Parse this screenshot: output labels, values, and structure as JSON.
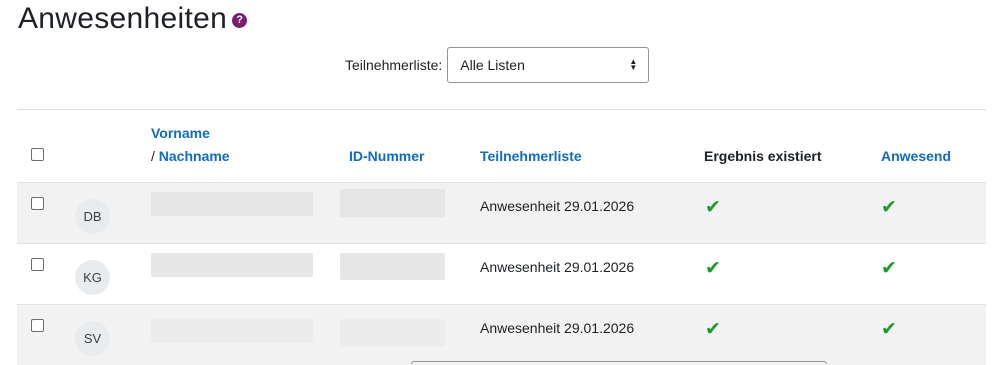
{
  "page": {
    "title": "Anwesenheiten",
    "help_icon": "?"
  },
  "filter": {
    "label": "Teilnehmerliste:",
    "selected": "Alle Listen"
  },
  "table": {
    "headers": {
      "firstname": "Vorname",
      "lastname_prefix": "/ ",
      "lastname": "Nachname",
      "idnumber": "ID-Nummer",
      "list": "Teilnehmerliste",
      "result": "Ergebnis existiert",
      "present": "Anwesend"
    },
    "rows": [
      {
        "initials": "DB",
        "list": "Anwesenheit 29.01.2026",
        "result_icon": "✔",
        "present_icon": "✔"
      },
      {
        "initials": "KG",
        "list": "Anwesenheit 29.01.2026",
        "result_icon": "✔",
        "present_icon": "✔"
      },
      {
        "initials": "SV",
        "list": "Anwesenheit 29.01.2026",
        "result_icon": "✔",
        "present_icon": "✔"
      }
    ]
  },
  "colors": {
    "link": "#0f6cbf",
    "check": "#1a9c2a",
    "help": "#7a1f6e",
    "stripe": "#f2f2f2"
  }
}
